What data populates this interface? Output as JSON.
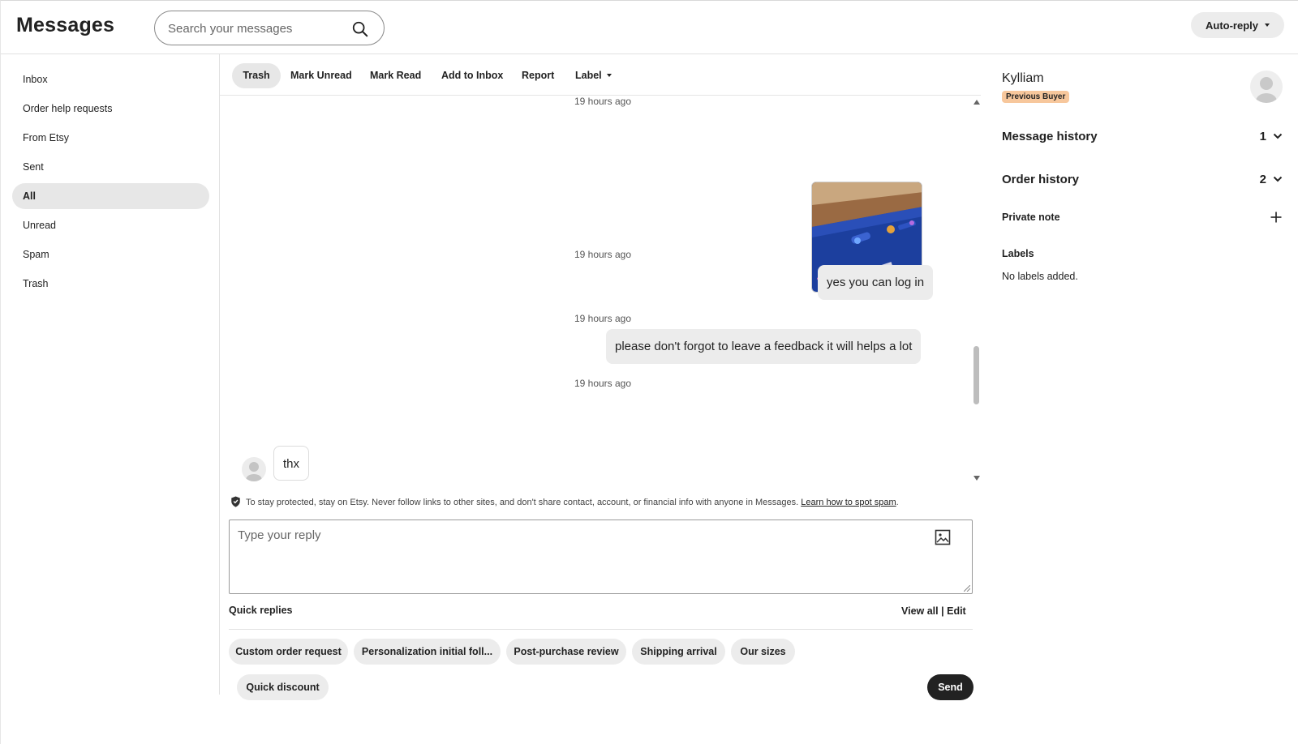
{
  "header": {
    "title": "Messages",
    "search_placeholder": "Search your messages",
    "auto_reply_label": "Auto-reply"
  },
  "sidebar": {
    "items": [
      {
        "label": "Inbox"
      },
      {
        "label": "Order help requests"
      },
      {
        "label": "From Etsy"
      },
      {
        "label": "Sent"
      },
      {
        "label": "All",
        "active": true
      },
      {
        "label": "Unread"
      },
      {
        "label": "Spam"
      },
      {
        "label": "Trash"
      }
    ]
  },
  "toolbar": {
    "trash": "Trash",
    "mark_unread": "Mark Unread",
    "mark_read": "Mark Read",
    "add_to_inbox": "Add to Inbox",
    "report": "Report",
    "label": "Label"
  },
  "thread": {
    "timestamps": [
      "19 hours ago",
      "19 hours ago",
      "19 hours ago",
      "19 hours ago"
    ],
    "messages": [
      {
        "from": "seller",
        "text": "yes you can log in"
      },
      {
        "from": "seller",
        "text": "please don't forgot to leave a feedback it will helps a lot"
      },
      {
        "from": "buyer",
        "text": "thx"
      }
    ]
  },
  "notice": {
    "text": "To stay protected, stay on Etsy. Never follow links to other sites, and don't share contact, account, or financial info with anyone in Messages.",
    "link": "Learn how to spot spam"
  },
  "reply": {
    "placeholder": "Type your reply",
    "send_label": "Send"
  },
  "quick_replies": {
    "title": "Quick replies",
    "view_all": "View all",
    "separator": "|",
    "edit": "Edit",
    "chips": [
      "Custom order request",
      "Personalization initial foll...",
      "Post-purchase review",
      "Shipping arrival",
      "Our sizes",
      "Quick discount"
    ]
  },
  "buyer": {
    "name": "Kylliam",
    "badge": "Previous Buyer",
    "message_history_label": "Message history",
    "message_history_count": "1",
    "order_history_label": "Order history",
    "order_history_count": "2",
    "private_note_label": "Private note",
    "labels_title": "Labels",
    "labels_empty": "No labels added."
  },
  "colors": {
    "badge_bg": "#f7c79c",
    "send_bg": "#222222",
    "chip_bg": "#ececec"
  }
}
